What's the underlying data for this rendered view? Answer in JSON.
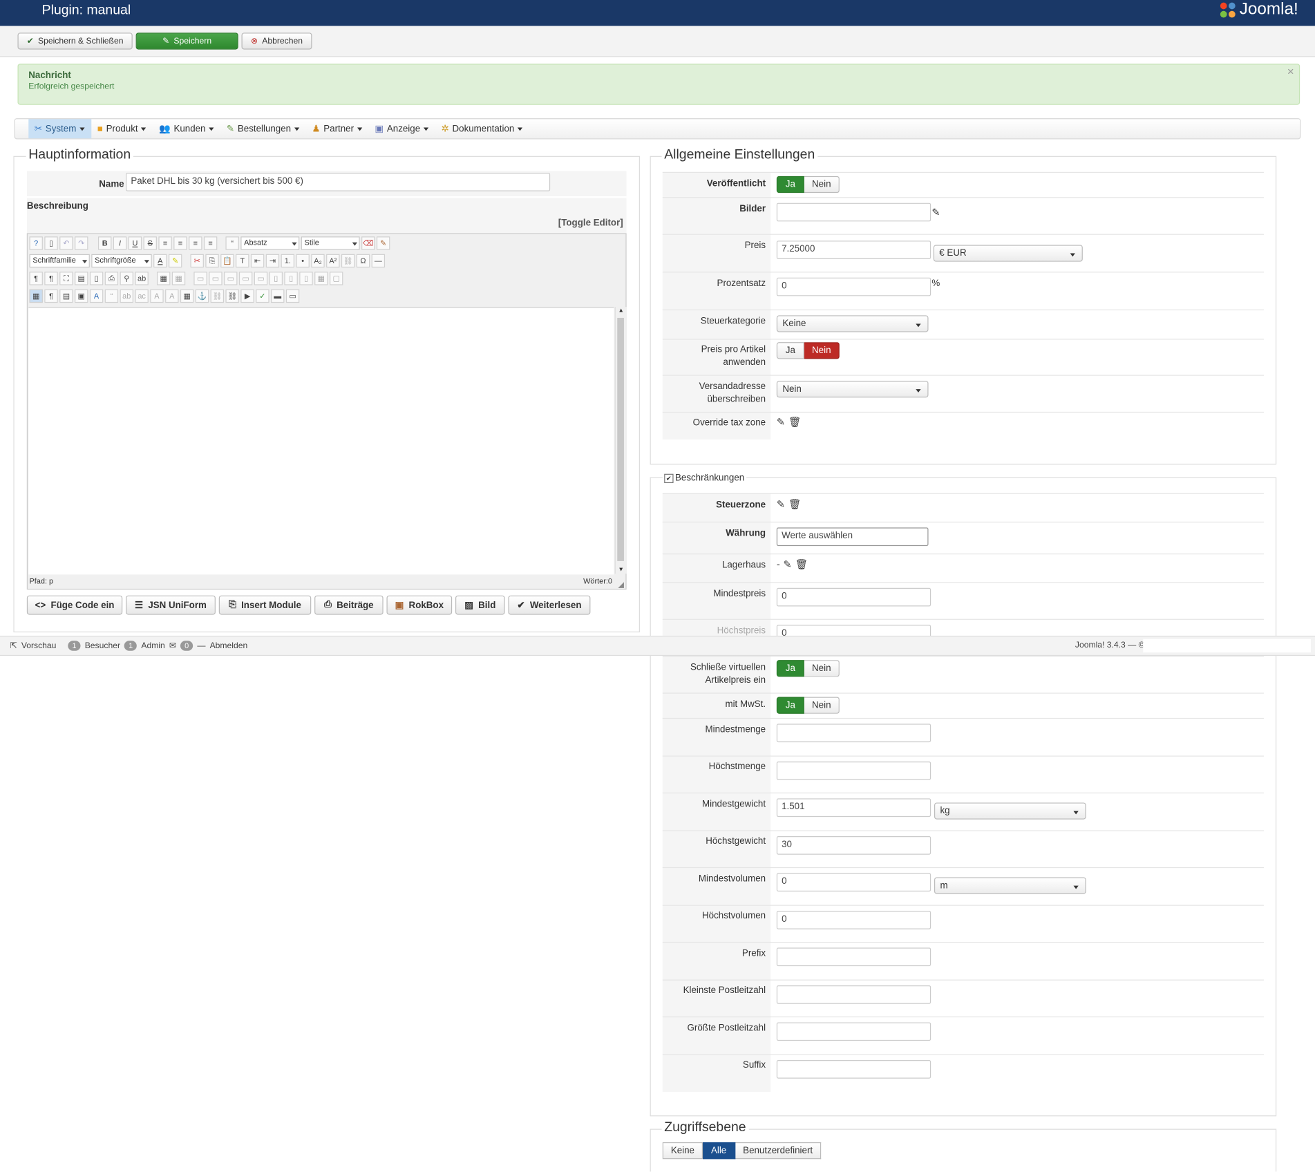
{
  "header": {
    "title": "Plugin: manual",
    "logo_text": "Joomla!"
  },
  "toolbar": {
    "save_close": "Speichern & Schließen",
    "save": "Speichern",
    "cancel": "Abbrechen"
  },
  "message": {
    "heading": "Nachricht",
    "body": "Erfolgreich gespeichert"
  },
  "menu": [
    "System",
    "Produkt",
    "Kunden",
    "Bestellungen",
    "Partner",
    "Anzeige",
    "Dokumentation"
  ],
  "main": {
    "legend": "Hauptinformation",
    "name_label": "Name",
    "name_value": "Paket DHL bis 30 kg (versichert bis 500 €)",
    "desc_label": "Beschreibung",
    "toggle_editor": "[Toggle Editor]",
    "editor": {
      "format": "Absatz",
      "styles": "Stile",
      "font_family": "Schriftfamilie",
      "font_size": "Schriftgröße",
      "path": "Pfad:  p",
      "words": "Wörter:0"
    },
    "editor_buttons": [
      "Füge Code ein",
      "JSN UniForm",
      "Insert Module",
      "Beiträge",
      "RokBox",
      "Bild",
      "Weiterlesen"
    ]
  },
  "general": {
    "legend": "Allgemeine Einstellungen",
    "published_label": "Veröffentlicht",
    "images_label": "Bilder",
    "price_label": "Preis",
    "price_value": "7.25000",
    "currency": "€ EUR",
    "percent_label": "Prozentsatz",
    "percent_value": "0",
    "percent_unit": "%",
    "tax_label": "Steuerkategorie",
    "tax_value": "Keine",
    "per_item_label": "Preis pro Artikel anwenden",
    "override_ship_label": "Versandadresse überschreiben",
    "override_ship_value": "Nein",
    "override_tax_label": "Override tax zone",
    "yes": "Ja",
    "no": "Nein"
  },
  "restrictions": {
    "legend": "Beschränkungen",
    "taxzone_label": "Steuerzone",
    "currency_label": "Währung",
    "currency_placeholder": "Werte auswählen",
    "warehouse_label": "Lagerhaus",
    "warehouse_value": "-",
    "min_price_label": "Mindestpreis",
    "min_price_value": "0",
    "max_price_label": "Höchstpreis",
    "max_price_value": "0",
    "virtual_label": "Schließe virtuellen Artikelpreis ein",
    "vat_label": "mit MwSt.",
    "min_qty_label": "Mindestmenge",
    "max_qty_label": "Höchstmenge",
    "min_weight_label": "Mindestgewicht",
    "min_weight_value": "1.501",
    "weight_unit": "kg",
    "max_weight_label": "Höchstgewicht",
    "max_weight_value": "30",
    "min_vol_label": "Mindestvolumen",
    "min_vol_value": "0",
    "vol_unit": "m",
    "max_vol_label": "Höchstvolumen",
    "max_vol_value": "0",
    "prefix_label": "Prefix",
    "min_zip_label": "Kleinste Postleitzahl",
    "max_zip_label": "Größte Postleitzahl",
    "suffix_label": "Suffix"
  },
  "access": {
    "legend": "Zugriffsebene",
    "options": [
      "Keine",
      "Alle",
      "Benutzerdefiniert"
    ],
    "selected": "Alle"
  },
  "statusbar": {
    "preview": "Vorschau",
    "visitors_count": "1",
    "visitors": "Besucher",
    "admin_count": "1",
    "admin": "Admin",
    "messages_count": "0",
    "logout": "Abmelden",
    "version": "Joomla! 3.4.3 — ©"
  },
  "colors": {
    "header_bg": "#1a3867",
    "success_bg": "#dff0d8",
    "green": "#2f8a32",
    "red": "#bd2a25",
    "blue": "#1a4f8e"
  }
}
